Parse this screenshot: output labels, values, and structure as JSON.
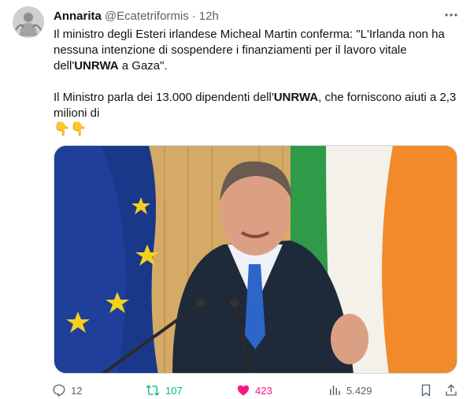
{
  "tweet": {
    "author_name": "Annarita",
    "author_handle": "@Ecatetriformis",
    "separator": "·",
    "time": "12h",
    "paragraph1_before": "Il ministro degli Esteri irlandese Micheal Martin conferma: \"L'Irlanda non ha nessuna intenzione di sospendere i finanziamenti per il lavoro vitale dell'",
    "paragraph1_bold": "UNRWA",
    "paragraph1_after": " a Gaza\".",
    "paragraph2_before": " Il Ministro parla  dei 13.000 dipendenti dell'",
    "paragraph2_bold": "UNRWA",
    "paragraph2_after": ", che forniscono aiuti a 2,3 milioni di",
    "emoji_line": "👇👇",
    "image_subject": "Micheal Martin speaking at microphones in front of EU and Irish flags"
  },
  "actions": {
    "replies": "12",
    "retweets": "107",
    "likes": "423",
    "views": "5.429"
  },
  "colors": {
    "text": "#0f1419",
    "secondary": "#536471",
    "retweet_active": "#00ba7c",
    "like_active": "#f91880",
    "border": "#cfd9de"
  },
  "icons": [
    "more-icon",
    "reply-icon",
    "retweet-icon",
    "like-icon",
    "views-icon",
    "bookmark-icon",
    "share-icon"
  ]
}
